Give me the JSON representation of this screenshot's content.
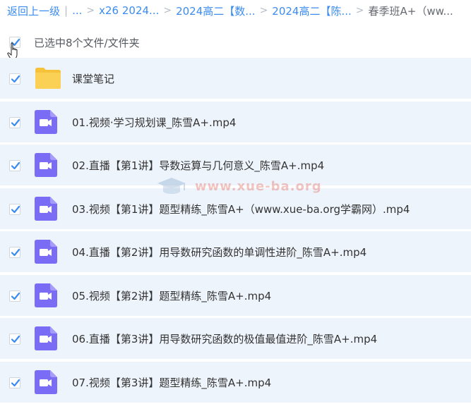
{
  "breadcrumb": {
    "back": "返回上一级",
    "ellipsis": "...",
    "items": [
      "x26 2024...",
      "2024高二【数...",
      "2024高二【陈..."
    ],
    "current": "春季班A+（ww..."
  },
  "selection": {
    "label": "已选中8个文件/文件夹",
    "checked": true
  },
  "files": [
    {
      "name": "课堂笔记",
      "type": "folder",
      "checked": true
    },
    {
      "name": "01.视频·学习规划课_陈雪A+.mp4",
      "type": "video",
      "checked": true
    },
    {
      "name": "02.直播【第1讲】导数运算与几何意义_陈雪A+.mp4",
      "type": "video",
      "checked": true
    },
    {
      "name": "03.视频【第1讲】题型精练_陈雪A+（www.xue-ba.org学霸网）.mp4",
      "type": "video",
      "checked": true
    },
    {
      "name": "04.直播【第2讲】用导数研究函数的单调性进阶_陈雪A+.mp4",
      "type": "video",
      "checked": true
    },
    {
      "name": "05.视频【第2讲】题型精练_陈雪A+.mp4",
      "type": "video",
      "checked": true
    },
    {
      "name": "06.直播【第3讲】用导数研究函数的极值最值进阶_陈雪A+.mp4",
      "type": "video",
      "checked": true
    },
    {
      "name": "07.视频【第3讲】题型精练_陈雪A+.mp4",
      "type": "video",
      "checked": true
    }
  ],
  "watermark": {
    "text": "www.xue-ba.org"
  },
  "colors": {
    "accent": "#3b8cf0",
    "row_bg": "#eef4fc",
    "video_icon": "#7b6cf6",
    "folder_icon": "#f7c23b"
  }
}
